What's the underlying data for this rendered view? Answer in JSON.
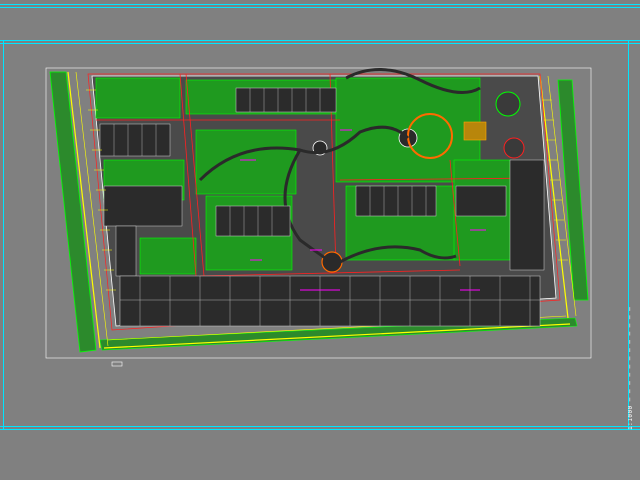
{
  "viewport": {
    "background": "#808080",
    "frame_color": "#00e5ff",
    "title_block_text": "1:1000 ─ ─ ─ ─ ─ ─ ─ ─ ─ ─ ─ ─"
  },
  "plan": {
    "colors": {
      "boundary": "#ffffff",
      "road": "#ffff00",
      "green": "#00ff00",
      "building": "#333333",
      "building_detail": "#d0d0d0",
      "property_line": "#ff2020",
      "annotation": "#ff00ff",
      "landscape_arc": "#ff6a00",
      "plaza_fill": "#b8860b"
    }
  }
}
